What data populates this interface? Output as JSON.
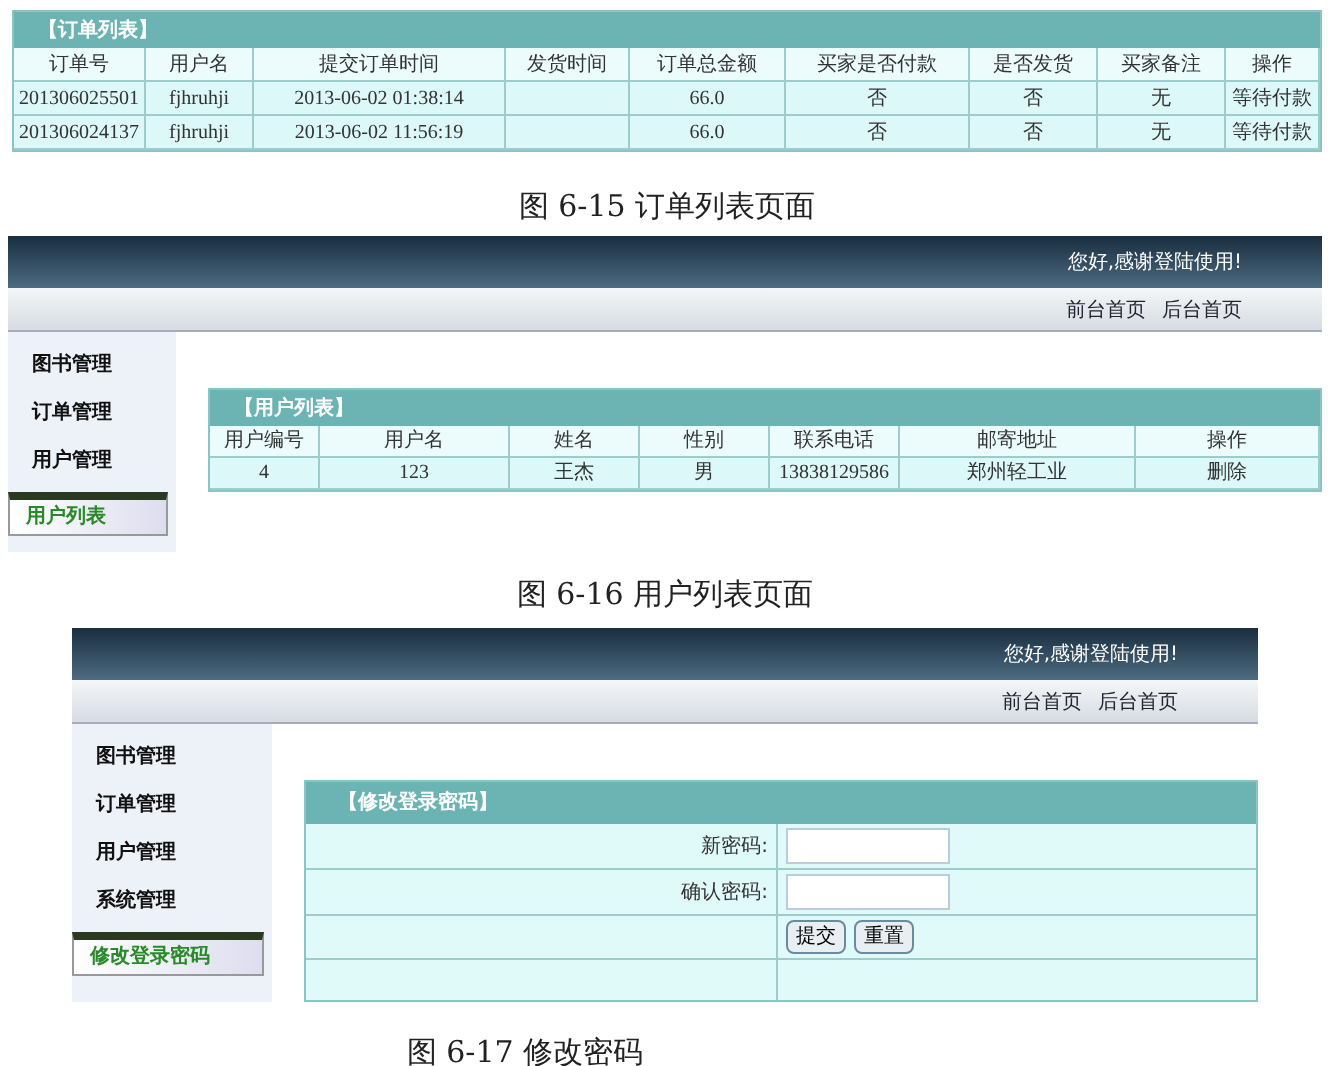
{
  "figures": [
    {
      "kind": "order_list",
      "panel_title": "【订单列表】",
      "columns": [
        "订单号",
        "用户名",
        "提交订单时间",
        "发货时间",
        "订单总金额",
        "买家是否付款",
        "是否发货",
        "买家备注",
        "操作"
      ],
      "rows": [
        [
          "201306025501",
          "fjhruhji",
          "2013-06-02 01:38:14",
          "",
          "66.0",
          "否",
          "否",
          "无",
          "等待付款"
        ],
        [
          "201306024137",
          "fjhruhji",
          "2013-06-02 11:56:19",
          "",
          "66.0",
          "否",
          "否",
          "无",
          "等待付款"
        ]
      ],
      "caption": "图 6-15 订单列表页面"
    },
    {
      "kind": "user_list",
      "greeting": "您好,感谢登陆使用!",
      "nav_links": [
        "前台首页",
        "后台首页"
      ],
      "sidebar": [
        {
          "label": "图书管理",
          "selected": false
        },
        {
          "label": "订单管理",
          "selected": false
        },
        {
          "label": "用户管理",
          "selected": false
        },
        {
          "label": "用户列表",
          "selected": true
        }
      ],
      "panel_title": "【用户列表】",
      "columns": [
        "用户编号",
        "用户名",
        "姓名",
        "性别",
        "联系电话",
        "邮寄地址",
        "操作"
      ],
      "rows": [
        [
          "4",
          "123",
          "王杰",
          "男",
          "13838129586",
          "郑州轻工业",
          "删除"
        ]
      ],
      "caption": "图 6-16 用户列表页面"
    },
    {
      "kind": "password_form",
      "greeting": "您好,感谢登陆使用!",
      "nav_links": [
        "前台首页",
        "后台首页"
      ],
      "sidebar": [
        {
          "label": "图书管理",
          "selected": false
        },
        {
          "label": "订单管理",
          "selected": false
        },
        {
          "label": "用户管理",
          "selected": false
        },
        {
          "label": "系统管理",
          "selected": false
        },
        {
          "label": "修改登录密码",
          "selected": true
        }
      ],
      "panel_title": "【修改登录密码】",
      "fields": [
        {
          "label": "新密码:"
        },
        {
          "label": "确认密码:"
        }
      ],
      "buttons": [
        "提交",
        "重置"
      ],
      "caption": "图 6-17 修改密码"
    }
  ]
}
